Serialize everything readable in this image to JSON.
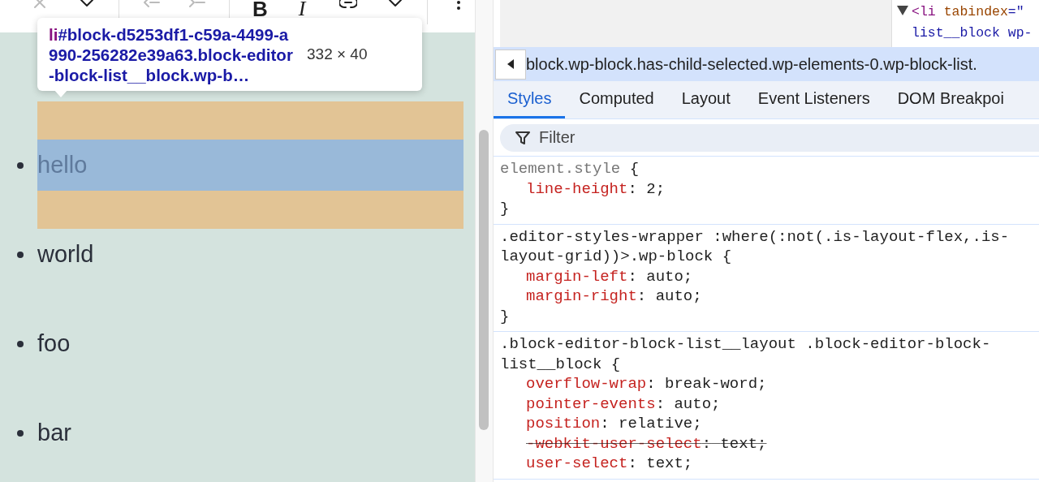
{
  "toolbar": {
    "bold": "B",
    "italic": "I"
  },
  "tooltip": {
    "tag": "li",
    "selector": "#block-d5253df1-c59a-4499-a990-256282e39a63.block-editor-block-list__block.wp-b…",
    "size": "332 × 40"
  },
  "list": [
    {
      "text": "hello",
      "selected": true
    },
    {
      "text": "world",
      "selected": false
    },
    {
      "text": "foo",
      "selected": false
    },
    {
      "text": "bar",
      "selected": false
    }
  ],
  "elements_tree": [
    {
      "kind": "open",
      "expanded": true,
      "tag": "<li",
      "attr": "tabindex",
      "value": "=\""
    },
    {
      "kind": "cont",
      "text": "list__block wp-"
    }
  ],
  "breadcrumb": "block.wp-block.has-child-selected.wp-elements-0.wp-block-list.",
  "tabs": [
    {
      "label": "Styles",
      "selected": true
    },
    {
      "label": "Computed",
      "selected": false
    },
    {
      "label": "Layout",
      "selected": false
    },
    {
      "label": "Event Listeners",
      "selected": false
    },
    {
      "label": "DOM Breakpoi",
      "selected": false
    }
  ],
  "filter": {
    "placeholder": "Filter"
  },
  "syntax": {
    "open": "{",
    "close": "}",
    "colon": ":",
    "semicolon": ";"
  },
  "rules": [
    {
      "kind": "inline",
      "closed": true,
      "selector": "element.style",
      "declarations": [
        {
          "name": "line-height",
          "value": "2",
          "overridden": false
        }
      ]
    },
    {
      "kind": "rule",
      "closed": true,
      "selector": ".editor-styles-wrapper :where(:not(.is-layout-flex,.is-layout-grid))>.wp-block",
      "declarations": [
        {
          "name": "margin-left",
          "value": "auto",
          "overridden": false
        },
        {
          "name": "margin-right",
          "value": "auto",
          "overridden": false
        }
      ]
    },
    {
      "kind": "rule",
      "closed": false,
      "selector": ".block-editor-block-list__layout .block-editor-block-list__block",
      "declarations": [
        {
          "name": "overflow-wrap",
          "value": "break-word",
          "overridden": false
        },
        {
          "name": "pointer-events",
          "value": "auto",
          "overridden": false
        },
        {
          "name": "position",
          "value": "relative",
          "overridden": false
        },
        {
          "name": "-webkit-user-select",
          "value": "text",
          "overridden": true
        },
        {
          "name": "user-select",
          "value": "text",
          "overridden": false
        }
      ]
    }
  ]
}
